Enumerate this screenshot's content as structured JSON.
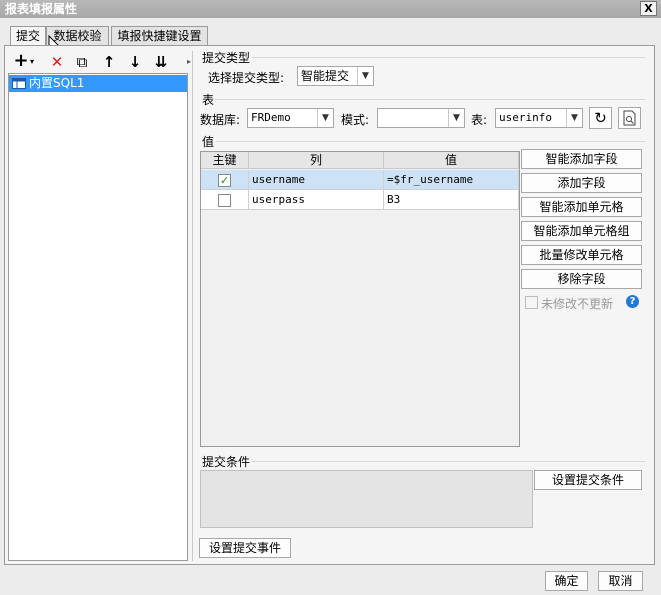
{
  "window": {
    "title": "报表填报属性",
    "close_label": "X"
  },
  "tabs": [
    {
      "label": "提交"
    },
    {
      "label": "数据校验"
    },
    {
      "label": "填报快捷键设置"
    }
  ],
  "left": {
    "toolbar": {
      "add": "+",
      "add_arrow": "▾",
      "delete": "✕",
      "copy": "⧉",
      "up": "↑",
      "down": "↓",
      "sort": "⇊",
      "more": "▸"
    },
    "items": [
      {
        "label": "内置SQL1"
      }
    ]
  },
  "submit_type": {
    "section": "提交类型",
    "label": "选择提交类型:",
    "value": "智能提交"
  },
  "table": {
    "section": "表",
    "db_label": "数据库:",
    "db_value": "FRDemo",
    "mode_label": "模式:",
    "mode_value": "",
    "table_label": "表:",
    "table_value": "userinfo"
  },
  "value": {
    "section": "值",
    "headers": {
      "key": "主键",
      "col": "列",
      "val": "值"
    },
    "rows": [
      {
        "checked": true,
        "col": "username",
        "val": "=$fr_username"
      },
      {
        "checked": false,
        "col": "userpass",
        "val": "B3"
      }
    ]
  },
  "side_buttons": {
    "smart_add_field": "智能添加字段",
    "add_field": "添加字段",
    "smart_add_cell": "智能添加单元格",
    "smart_add_cell_group": "智能添加单元格组",
    "batch_modify": "批量修改单元格",
    "remove_field": "移除字段",
    "no_update_label": "未修改不更新",
    "help": "?"
  },
  "condition": {
    "section": "提交条件",
    "button": "设置提交条件"
  },
  "event_button": "设置提交事件",
  "footer": {
    "ok": "确定",
    "cancel": "取消"
  },
  "colors": {
    "selection": "#3399ff",
    "help": "#1f7ad6",
    "row_sel": "#cde3f5"
  }
}
